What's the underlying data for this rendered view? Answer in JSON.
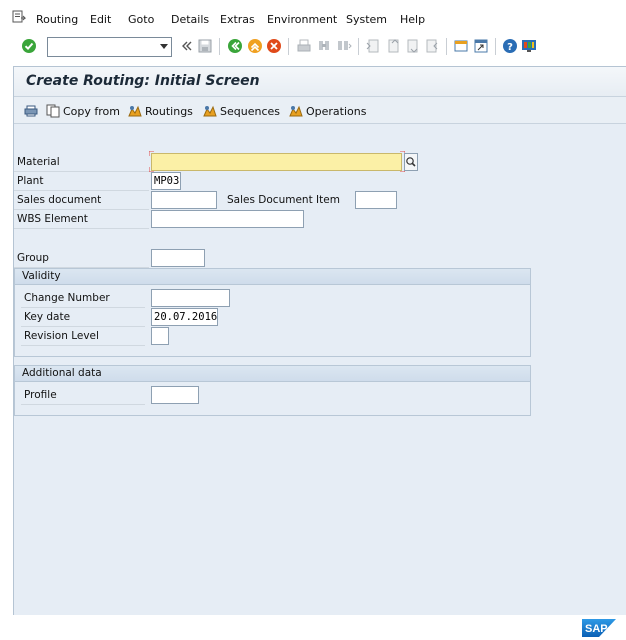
{
  "menu": {
    "items": [
      "Routing",
      "Edit",
      "Goto",
      "Details",
      "Extras",
      "Environment",
      "System",
      "Help"
    ]
  },
  "toolbar": {
    "command_field_value": ""
  },
  "screen": {
    "title": "Create Routing: Initial Screen",
    "app_toolbar": {
      "copy_from": "Copy from",
      "routings": "Routings",
      "sequences": "Sequences",
      "operations": "Operations"
    },
    "fields": {
      "material": {
        "label": "Material",
        "value": ""
      },
      "plant": {
        "label": "Plant",
        "value": "MP03"
      },
      "sales_document": {
        "label": "Sales document",
        "value": ""
      },
      "sales_document_item": {
        "label": "Sales Document Item",
        "value": ""
      },
      "wbs_element": {
        "label": "WBS Element",
        "value": ""
      },
      "group": {
        "label": "Group",
        "value": ""
      }
    },
    "validity": {
      "title": "Validity",
      "change_number": {
        "label": "Change Number",
        "value": ""
      },
      "key_date": {
        "label": "Key date",
        "value": "20.07.2016"
      },
      "revision_level": {
        "label": "Revision Level",
        "value": ""
      }
    },
    "additional_data": {
      "title": "Additional data",
      "profile": {
        "label": "Profile",
        "value": ""
      }
    }
  },
  "colors": {
    "screen_bg": "#e6edf5",
    "required_field": "#fbf0a6",
    "sap_blue": "#1a7ad0"
  },
  "logo": "SAP"
}
